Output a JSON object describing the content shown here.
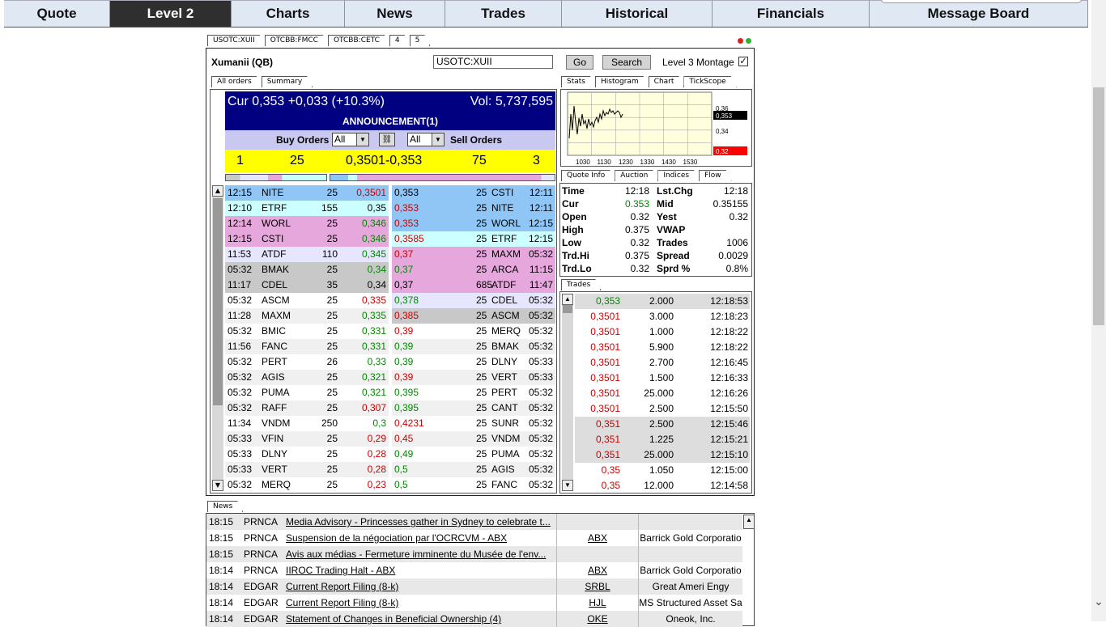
{
  "nav": [
    "Quote",
    "Level 2",
    "Charts",
    "News",
    "Trades",
    "Historical",
    "Financials",
    "Message Board"
  ],
  "symbol_tabs": [
    "USOTC:XUII",
    "OTCBB:FMCC",
    "OTCBB:CETC",
    "4",
    "5"
  ],
  "header": {
    "name": "Xumanii (QB)",
    "symbol": "USOTC:XUII",
    "go": "Go",
    "search": "Search",
    "montage": "Level 3 Montage",
    "check": "✓"
  },
  "sub_tabs": [
    "All orders",
    "Summary"
  ],
  "cur_line": "Cur 0,353 +0,033 (+10.3%)",
  "vol_line": "Vol: 5,737,595",
  "announcement": "ANNOUNCEMENT(1)",
  "buy_label": "Buy Orders",
  "sell_label": "Sell Orders",
  "filter": "All",
  "summary": {
    "bid_count": "1",
    "bid_size": "25",
    "spread": "0,3501-0,353",
    "ask_size": "75",
    "ask_count": "3"
  },
  "colors": {
    "c1": "#8fc6f5",
    "c2": "#ccffff",
    "c3": "#e6a8dc",
    "c4": "#e6e6ff",
    "c5": "#c8c8c8"
  },
  "bids": [
    [
      "12:15",
      "NITE",
      "25",
      "0,3501",
      "c1",
      "red"
    ],
    [
      "12:10",
      "ETRF",
      "155",
      "0,35",
      "c2",
      ""
    ],
    [
      "12:14",
      "WORL",
      "25",
      "0,346",
      "c3",
      "grn"
    ],
    [
      "12:15",
      "CSTI",
      "25",
      "0,346",
      "c3",
      "grn"
    ],
    [
      "11:53",
      "ATDF",
      "110",
      "0,345",
      "c4",
      "grn"
    ],
    [
      "05:32",
      "BMAK",
      "25",
      "0,34",
      "c5",
      "grn"
    ],
    [
      "11:17",
      "CDEL",
      "35",
      "0,34",
      "c5",
      ""
    ],
    [
      "05:32",
      "ASCM",
      "25",
      "0,335",
      "",
      "red"
    ],
    [
      "11:28",
      "MAXM",
      "25",
      "0,335",
      "",
      "grn"
    ],
    [
      "05:32",
      "BMIC",
      "25",
      "0,331",
      "",
      "grn"
    ],
    [
      "11:56",
      "FANC",
      "25",
      "0,331",
      "",
      "grn"
    ],
    [
      "05:32",
      "PERT",
      "26",
      "0,33",
      "",
      "grn"
    ],
    [
      "05:32",
      "AGIS",
      "25",
      "0,321",
      "",
      "grn"
    ],
    [
      "05:32",
      "PUMA",
      "25",
      "0,321",
      "",
      "grn"
    ],
    [
      "05:32",
      "RAFF",
      "25",
      "0,307",
      "",
      "red"
    ],
    [
      "11:34",
      "VNDM",
      "250",
      "0,3",
      "",
      "grn"
    ],
    [
      "05:33",
      "VFIN",
      "25",
      "0,29",
      "",
      "red"
    ],
    [
      "05:33",
      "DLNY",
      "25",
      "0,28",
      "",
      "red"
    ],
    [
      "05:33",
      "VERT",
      "25",
      "0,28",
      "",
      "red"
    ],
    [
      "05:32",
      "MERQ",
      "25",
      "0,23",
      "",
      "red"
    ]
  ],
  "asks": [
    [
      "0,353",
      "25",
      "CSTI",
      "12:11",
      "c1",
      ""
    ],
    [
      "0,353",
      "25",
      "NITE",
      "12:11",
      "c1",
      "red"
    ],
    [
      "0,353",
      "25",
      "WORL",
      "12:15",
      "c1",
      "red"
    ],
    [
      "0,3585",
      "25",
      "ETRF",
      "12:15",
      "c2",
      "red"
    ],
    [
      "0,37",
      "25",
      "MAXM",
      "05:32",
      "c3",
      "red"
    ],
    [
      "0,37",
      "25",
      "ARCA",
      "11:15",
      "c3",
      "grn"
    ],
    [
      "0,37",
      "685",
      "ATDF",
      "11:47",
      "c3",
      ""
    ],
    [
      "0,378",
      "25",
      "CDEL",
      "05:32",
      "c4",
      "grn"
    ],
    [
      "0,385",
      "25",
      "ASCM",
      "05:32",
      "c5",
      "red"
    ],
    [
      "0,39",
      "25",
      "MERQ",
      "05:32",
      "",
      "red"
    ],
    [
      "0,39",
      "25",
      "BMAK",
      "05:32",
      "",
      "grn"
    ],
    [
      "0,39",
      "25",
      "DLNY",
      "05:33",
      "",
      "grn"
    ],
    [
      "0,39",
      "25",
      "VERT",
      "05:33",
      "",
      "red"
    ],
    [
      "0,395",
      "25",
      "PERT",
      "05:32",
      "",
      "grn"
    ],
    [
      "0,395",
      "25",
      "CANT",
      "05:32",
      "",
      "grn"
    ],
    [
      "0,4231",
      "25",
      "SUNR",
      "05:32",
      "",
      "red"
    ],
    [
      "0,45",
      "25",
      "VNDM",
      "05:32",
      "",
      "red"
    ],
    [
      "0,49",
      "25",
      "PUMA",
      "05:32",
      "",
      "grn"
    ],
    [
      "0,5",
      "25",
      "AGIS",
      "05:32",
      "",
      "grn"
    ],
    [
      "0,5",
      "25",
      "FANC",
      "05:32",
      "",
      "grn"
    ]
  ],
  "right_tabs": [
    "Stats",
    "Histogram",
    "Chart",
    "TickScope"
  ],
  "chart": {
    "y_labels": [
      "0,36",
      "0,353",
      "0,34",
      "0,32"
    ],
    "x_labels": [
      "1030",
      "1130",
      "1230",
      "1330",
      "1430",
      "1530"
    ]
  },
  "quote_tabs": [
    "Quote Info",
    "Auction",
    "Indices",
    "Flow"
  ],
  "quote_info": [
    [
      "Time",
      "12:18",
      "Lst.Chg",
      "12:18"
    ],
    [
      "Cur",
      "0.353",
      "Mid",
      "0.35155"
    ],
    [
      "Open",
      "0.32",
      "Yest",
      "0.32"
    ],
    [
      "High",
      "0.375",
      "VWAP",
      ""
    ],
    [
      "Low",
      "0.32",
      "Trades",
      "1006"
    ],
    [
      "Trd.Hi",
      "0.375",
      "Spread",
      "0.0029"
    ],
    [
      "Trd.Lo",
      "0.32",
      "Sprd %",
      "0.8%"
    ]
  ],
  "trades_tab": "Trades",
  "trades": [
    [
      "0,353",
      "2.000",
      "12:18:53",
      "grn",
      "#ddd"
    ],
    [
      "0,3501",
      "3.000",
      "12:18:23",
      "red",
      ""
    ],
    [
      "0,3501",
      "1.000",
      "12:18:22",
      "red",
      ""
    ],
    [
      "0,3501",
      "5.900",
      "12:18:22",
      "red",
      ""
    ],
    [
      "0,3501",
      "2.700",
      "12:16:45",
      "red",
      ""
    ],
    [
      "0,3501",
      "1.500",
      "12:16:33",
      "red",
      ""
    ],
    [
      "0,3501",
      "25.000",
      "12:16:26",
      "red",
      ""
    ],
    [
      "0,3501",
      "2.500",
      "12:15:50",
      "red",
      ""
    ],
    [
      "0,351",
      "2.500",
      "12:15:46",
      "red",
      "#ddd"
    ],
    [
      "0,351",
      "1.225",
      "12:15:21",
      "red",
      "#ddd"
    ],
    [
      "0,351",
      "25.000",
      "12:15:10",
      "red",
      "#ddd"
    ],
    [
      "0,35",
      "1.050",
      "12:15:00",
      "red",
      ""
    ],
    [
      "0,35",
      "12.000",
      "12:14:58",
      "red",
      ""
    ]
  ],
  "news_tab": "News",
  "news": [
    [
      "18:15",
      "PRNCA",
      "Media Advisory - Princesses gather in Sydney to celebrate t...",
      "",
      ""
    ],
    [
      "18:15",
      "PRNCA",
      "Suspension de la négociation par l'OCRCVM - ABX",
      "ABX",
      "Barrick Gold Corporatio"
    ],
    [
      "18:15",
      "PRNCA",
      "Avis aux médias - Fermeture imminente du Musée de l'env...",
      "",
      ""
    ],
    [
      "18:14",
      "PRNCA",
      "IIROC Trading Halt - ABX",
      "ABX",
      "Barrick Gold Corporatio"
    ],
    [
      "18:14",
      "EDGAR",
      "Current Report Filing (8-k)",
      "SRBL",
      "Great Ameri Engy"
    ],
    [
      "18:14",
      "EDGAR",
      "Current Report Filing (8-k)",
      "HJL",
      "MS Structured Asset Sa"
    ],
    [
      "18:14",
      "EDGAR",
      "Statement of Changes in Beneficial Ownership (4)",
      "OKE",
      "Oneok, Inc."
    ]
  ]
}
